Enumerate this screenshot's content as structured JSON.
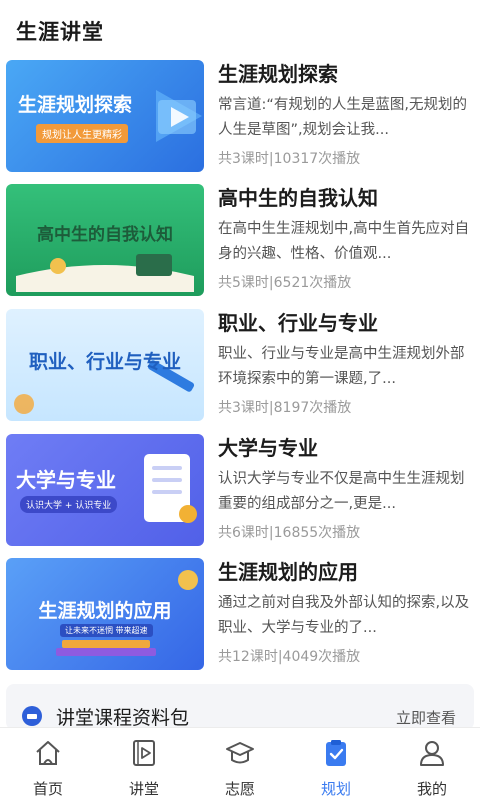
{
  "header": {
    "title": "生涯讲堂"
  },
  "courses": [
    {
      "title": "生涯规划探索",
      "description": "常言道:“有规划的人生是蓝图,无规划的人生是草图”,规划会让我...",
      "meta": "共3课时|10317次播放",
      "banner_text": "生涯规划探索",
      "banner_subtext": "规划让人生更精彩"
    },
    {
      "title": "高中生的自我认知",
      "description": "在高中生生涯规划中,高中生首先应对自身的兴趣、性格、价值观...",
      "meta": "共5课时|6521次播放",
      "banner_text": "高中生的自我认知",
      "banner_subtext": ""
    },
    {
      "title": "职业、行业与专业",
      "description": "职业、行业与专业是高中生涯规划外部环境探索中的第一课题,了...",
      "meta": "共3课时|8197次播放",
      "banner_text": "职业、行业与专业",
      "banner_subtext": ""
    },
    {
      "title": "大学与专业",
      "description": "认识大学与专业不仅是高中生生涯规划重要的组成部分之一,更是...",
      "meta": "共6课时|16855次播放",
      "banner_text": "大学与专业",
      "banner_subtext": "认识大学 + 认识专业"
    },
    {
      "title": "生涯规划的应用",
      "description": "通过之前对自我及外部认知的探索,以及职业、大学与专业的了...",
      "meta": "共12课时|4049次播放",
      "banner_text": "生涯规划的应用",
      "banner_subtext": "让未来不迷惘 带来超速"
    }
  ],
  "package": {
    "title": "讲堂课程资料包",
    "link": "立即查看"
  },
  "tabbar": [
    {
      "label": "首页",
      "icon": "home-icon"
    },
    {
      "label": "讲堂",
      "icon": "video-icon"
    },
    {
      "label": "志愿",
      "icon": "graduation-cap-icon"
    },
    {
      "label": "规划",
      "icon": "clipboard-icon",
      "active": true
    },
    {
      "label": "我的",
      "icon": "user-icon"
    }
  ],
  "colors": {
    "accent": "#3a7bf0",
    "text": "#1c1c1c",
    "meta": "#9a9a9a"
  }
}
